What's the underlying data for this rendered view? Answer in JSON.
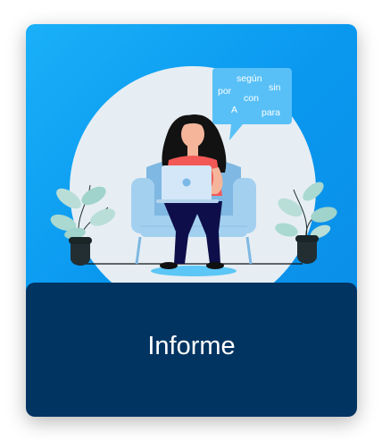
{
  "card": {
    "title": "Informe",
    "colors": {
      "hero_background": "#0a98ef",
      "footer_background": "#023462",
      "bubble": "#58c0f7",
      "title_text": "#ffffff"
    }
  },
  "illustration": {
    "subject": "woman-with-laptop",
    "speech_bubble_words": [
      "según",
      "por",
      "sin",
      "con",
      "A",
      "para"
    ]
  }
}
